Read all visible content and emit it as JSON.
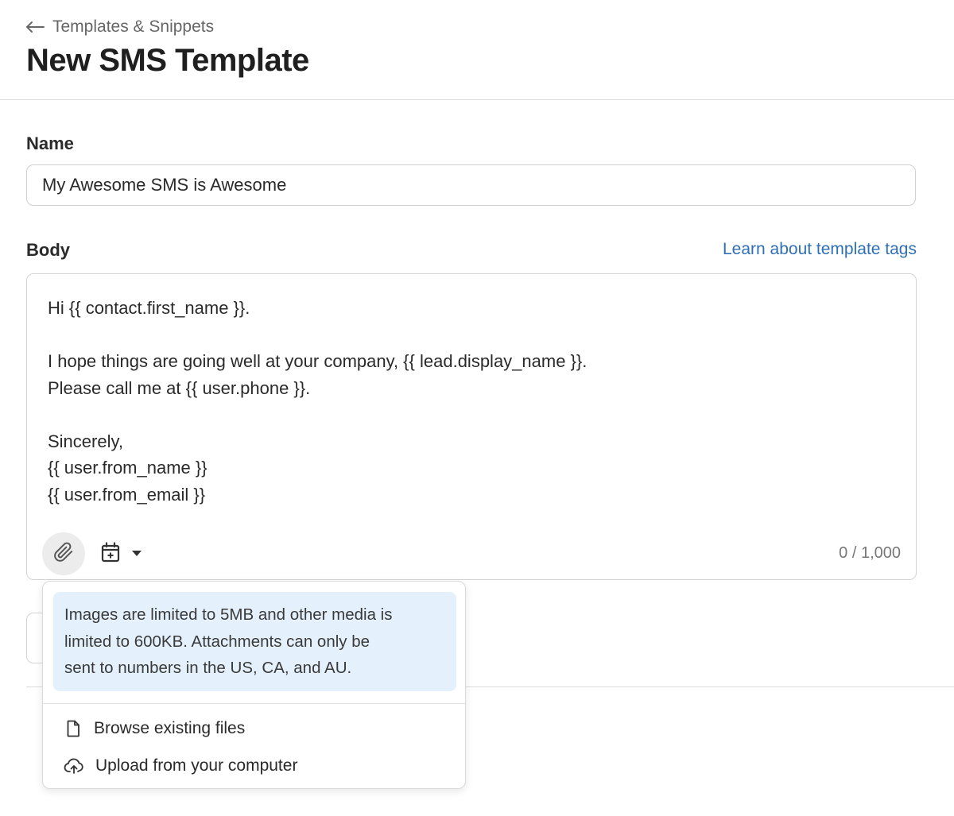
{
  "header": {
    "back_label": "Templates & Snippets",
    "title": "New SMS Template"
  },
  "form": {
    "name_label": "Name",
    "name_value": "My Awesome SMS is Awesome",
    "body_label": "Body",
    "learn_link": "Learn about template tags",
    "body_lines": [
      "Hi {{ contact.first_name }}.",
      "",
      "I hope things are going well at your company, {{ lead.display_name }}.",
      "Please call me at {{ user.phone }}.",
      "",
      "Sincerely,",
      "{{ user.from_name }}",
      "{{ user.from_email }}"
    ],
    "char_count": "0 / 1,000"
  },
  "attachment_popover": {
    "info_lines": [
      "Images are limited to 5MB and other media is",
      "limited to 600KB. Attachments can only be",
      "sent to numbers in the US, CA, and AU."
    ],
    "items": [
      {
        "label": "Browse existing files",
        "icon": "file-icon"
      },
      {
        "label": "Upload from your computer",
        "icon": "cloud-upload-icon"
      }
    ]
  },
  "colors": {
    "link": "#2f6fb6",
    "info_background": "#e4f1fc",
    "attach_button_background": "#ececec"
  }
}
